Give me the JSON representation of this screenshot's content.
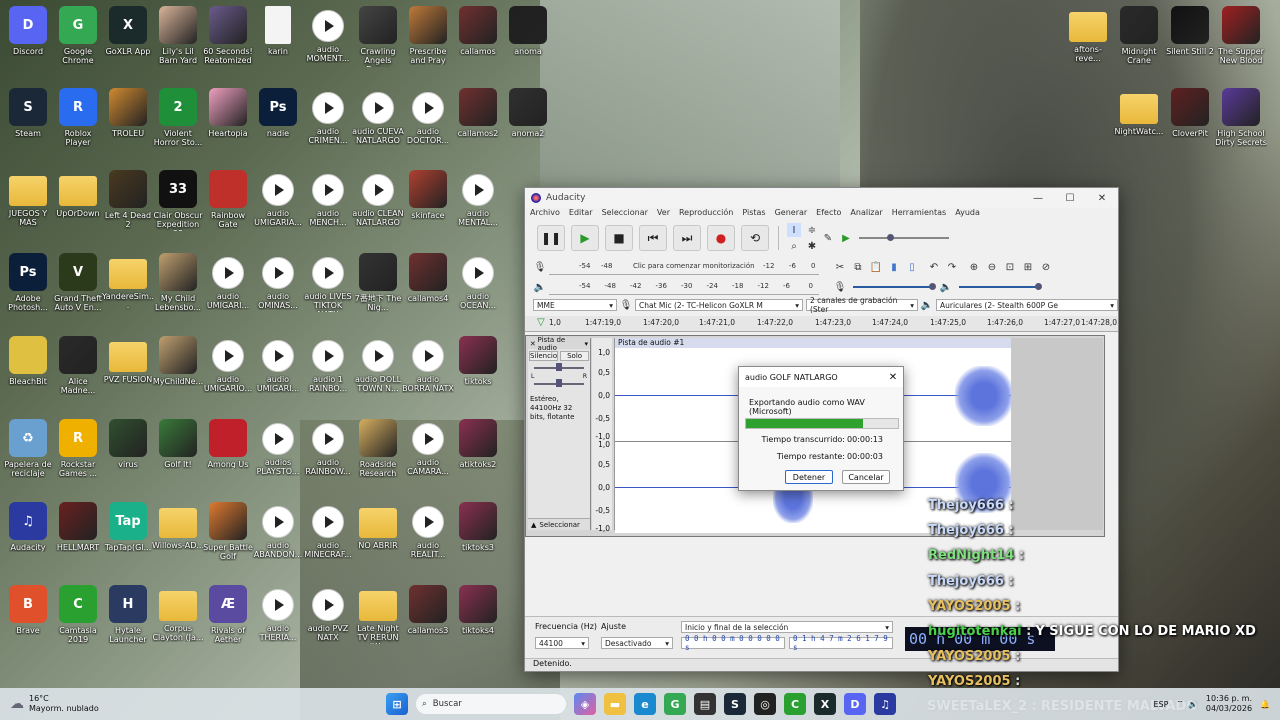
{
  "desktop_icons": [
    {
      "label": "Discord",
      "kind": "app",
      "color": "#5865f2",
      "glyph": "D"
    },
    {
      "label": "Google Chrome",
      "kind": "app",
      "color": "#34a853",
      "glyph": "G"
    },
    {
      "label": "GoXLR App",
      "kind": "app",
      "color": "#1b2a2a",
      "glyph": "X"
    },
    {
      "label": "Lily's Lil Barn Yard",
      "kind": "thumb",
      "color": "#d9b49a",
      "glyph": ""
    },
    {
      "label": "60 Seconds! Reatomized",
      "kind": "thumb",
      "color": "#6b5b8c",
      "glyph": ""
    },
    {
      "label": "karin",
      "kind": "file",
      "color": "#f4f4f4",
      "glyph": ""
    },
    {
      "label": "audio MOMENT...",
      "kind": "audio",
      "color": "#fff",
      "glyph": ""
    },
    {
      "label": "Crawling Angels Demo",
      "kind": "thumb",
      "color": "#444",
      "glyph": ""
    },
    {
      "label": "Prescribe and Pray",
      "kind": "thumb",
      "color": "#c07a3a",
      "glyph": ""
    },
    {
      "label": "callamos",
      "kind": "thumb",
      "color": "#703030",
      "glyph": ""
    },
    {
      "label": "anoma",
      "kind": "thumb",
      "color": "#202020",
      "glyph": ""
    },
    {
      "label": "Steam",
      "kind": "app",
      "color": "#1b2838",
      "glyph": "S"
    },
    {
      "label": "Roblox Player",
      "kind": "app",
      "color": "#2a6cf0",
      "glyph": "R"
    },
    {
      "label": "TROLEU",
      "kind": "thumb",
      "color": "#d08a30",
      "glyph": ""
    },
    {
      "label": "Violent Horror Sto...",
      "kind": "app",
      "color": "#1f8f3a",
      "glyph": "2"
    },
    {
      "label": "Heartopia",
      "kind": "thumb",
      "color": "#f0a0c0",
      "glyph": ""
    },
    {
      "label": "nadie",
      "kind": "app",
      "color": "#0b1e3a",
      "glyph": "Ps"
    },
    {
      "label": "audio CRIMEN...",
      "kind": "audio",
      "color": "#fff",
      "glyph": ""
    },
    {
      "label": "audio CUEVA NATLARGO",
      "kind": "audio",
      "color": "#fff",
      "glyph": ""
    },
    {
      "label": "audio DOCTOR...",
      "kind": "audio",
      "color": "#fff",
      "glyph": ""
    },
    {
      "label": "callamos2",
      "kind": "thumb",
      "color": "#703030",
      "glyph": ""
    },
    {
      "label": "anoma2",
      "kind": "thumb",
      "color": "#303030",
      "glyph": ""
    },
    {
      "label": "JUEGOS Y MAS",
      "kind": "folder",
      "color": "#f0c850",
      "glyph": ""
    },
    {
      "label": "UpOrDown",
      "kind": "folder",
      "color": "#f0c850",
      "glyph": ""
    },
    {
      "label": "Left 4 Dead 2",
      "kind": "thumb",
      "color": "#4a3a20",
      "glyph": ""
    },
    {
      "label": "Clair Obscur Expedition 33",
      "kind": "app",
      "color": "#111",
      "glyph": "33"
    },
    {
      "label": "Rainbow Gate",
      "kind": "app",
      "color": "#c0302a",
      "glyph": ""
    },
    {
      "label": "audio UMIGARIA...",
      "kind": "audio",
      "color": "#fff",
      "glyph": ""
    },
    {
      "label": "audio MENCH...",
      "kind": "audio",
      "color": "#fff",
      "glyph": ""
    },
    {
      "label": "audio CLEAN NATLARGO",
      "kind": "audio",
      "color": "#fff",
      "glyph": ""
    },
    {
      "label": "skinface",
      "kind": "thumb",
      "color": "#b04030",
      "glyph": ""
    },
    {
      "label": "audio MENTAL...",
      "kind": "audio",
      "color": "#fff",
      "glyph": ""
    },
    {
      "label": "Adobe Photosh...",
      "kind": "app",
      "color": "#0b1e3a",
      "glyph": "Ps"
    },
    {
      "label": "Grand Theft Auto V En...",
      "kind": "app",
      "color": "#2a3a1a",
      "glyph": "V"
    },
    {
      "label": "YandereSim...",
      "kind": "folder",
      "color": "#f0c850",
      "glyph": ""
    },
    {
      "label": "My Child Lebensbo...",
      "kind": "thumb",
      "color": "#c0a070",
      "glyph": ""
    },
    {
      "label": "audio UMIGARI...",
      "kind": "audio",
      "color": "#fff",
      "glyph": ""
    },
    {
      "label": "audio OMINAS...",
      "kind": "audio",
      "color": "#fff",
      "glyph": ""
    },
    {
      "label": "audio LIVES TIKTOK NATX",
      "kind": "audio",
      "color": "#fff",
      "glyph": ""
    },
    {
      "label": "7番地下 The Nig...",
      "kind": "thumb",
      "color": "#333",
      "glyph": ""
    },
    {
      "label": "callamos4",
      "kind": "thumb",
      "color": "#703030",
      "glyph": ""
    },
    {
      "label": "audio OCEAN...",
      "kind": "audio",
      "color": "#fff",
      "glyph": ""
    },
    {
      "label": "BleachBit",
      "kind": "app",
      "color": "#e0c040",
      "glyph": ""
    },
    {
      "label": "Alice Madne...",
      "kind": "thumb",
      "color": "#2a2a2a",
      "glyph": ""
    },
    {
      "label": "PVZ FUSION",
      "kind": "folder",
      "color": "#f0c850",
      "glyph": ""
    },
    {
      "label": "MyChildNe...",
      "kind": "thumb",
      "color": "#c0a070",
      "glyph": ""
    },
    {
      "label": "audio UMIGARIO...",
      "kind": "audio",
      "color": "#fff",
      "glyph": ""
    },
    {
      "label": "audio UMIGARI...",
      "kind": "audio",
      "color": "#fff",
      "glyph": ""
    },
    {
      "label": "audio 1 RAINBO...",
      "kind": "audio",
      "color": "#fff",
      "glyph": ""
    },
    {
      "label": "audio DOLL TOWN N...",
      "kind": "audio",
      "color": "#fff",
      "glyph": ""
    },
    {
      "label": "audio BORRA NATX",
      "kind": "audio",
      "color": "#fff",
      "glyph": ""
    },
    {
      "label": "tiktoks",
      "kind": "thumb",
      "color": "#8a3050",
      "glyph": ""
    },
    {
      "label": "Papelera de reciclaje",
      "kind": "app",
      "color": "#6aa0d0",
      "glyph": "♻"
    },
    {
      "label": "Rockstar Games ...",
      "kind": "app",
      "color": "#f0b000",
      "glyph": "R"
    },
    {
      "label": "virus",
      "kind": "thumb",
      "color": "#305030",
      "glyph": ""
    },
    {
      "label": "Golf It!",
      "kind": "thumb",
      "color": "#3a7a3a",
      "glyph": ""
    },
    {
      "label": "Among Us",
      "kind": "app",
      "color": "#c0202a",
      "glyph": ""
    },
    {
      "label": "audios PLAYSTO...",
      "kind": "audio",
      "color": "#fff",
      "glyph": ""
    },
    {
      "label": "audio RAINBOW...",
      "kind": "audio",
      "color": "#fff",
      "glyph": ""
    },
    {
      "label": "Roadside Research",
      "kind": "thumb",
      "color": "#d8b060",
      "glyph": ""
    },
    {
      "label": "audio CAMARA...",
      "kind": "audio",
      "color": "#fff",
      "glyph": ""
    },
    {
      "label": "atiktoks2",
      "kind": "thumb",
      "color": "#8a3050",
      "glyph": ""
    },
    {
      "label": "Audacity",
      "kind": "app",
      "color": "#2a3aa0",
      "glyph": "♫"
    },
    {
      "label": "HELLMART",
      "kind": "thumb",
      "color": "#6a2020",
      "glyph": ""
    },
    {
      "label": "TapTap(Gl...",
      "kind": "app",
      "color": "#1ab08a",
      "glyph": "Tap"
    },
    {
      "label": "Willows-AD...",
      "kind": "folder",
      "color": "#f0c850",
      "glyph": ""
    },
    {
      "label": "Super Battle Golf",
      "kind": "thumb",
      "color": "#e07a30",
      "glyph": ""
    },
    {
      "label": "audio ABANDON...",
      "kind": "audio",
      "color": "#fff",
      "glyph": ""
    },
    {
      "label": "audio MINECRAF...",
      "kind": "audio",
      "color": "#fff",
      "glyph": ""
    },
    {
      "label": "NO ABRIR",
      "kind": "folder",
      "color": "#f0c850",
      "glyph": ""
    },
    {
      "label": "audio REALIT...",
      "kind": "audio",
      "color": "#fff",
      "glyph": ""
    },
    {
      "label": "tiktoks3",
      "kind": "thumb",
      "color": "#8a3050",
      "glyph": ""
    },
    {
      "label": "Brave",
      "kind": "app",
      "color": "#e0502a",
      "glyph": "B"
    },
    {
      "label": "Camtasia 2019",
      "kind": "app",
      "color": "#2aa030",
      "glyph": "C"
    },
    {
      "label": "Hytale Launcher",
      "kind": "app",
      "color": "#2a3a60",
      "glyph": "H"
    },
    {
      "label": "Corpus Clayton (Ja...",
      "kind": "folder",
      "color": "#f0c850",
      "glyph": ""
    },
    {
      "label": "Rivals of Aether",
      "kind": "app",
      "color": "#5a4aa0",
      "glyph": "Æ"
    },
    {
      "label": "audio THERIA...",
      "kind": "audio",
      "color": "#fff",
      "glyph": ""
    },
    {
      "label": "audio PVZ NATX",
      "kind": "audio",
      "color": "#fff",
      "glyph": ""
    },
    {
      "label": "Late Night TV RERUN (W...",
      "kind": "folder",
      "color": "#f0c850",
      "glyph": ""
    },
    {
      "label": "callamos3",
      "kind": "thumb",
      "color": "#703030",
      "glyph": ""
    },
    {
      "label": "tiktoks4",
      "kind": "thumb",
      "color": "#8a3050",
      "glyph": ""
    }
  ],
  "desktop_icons_right": [
    {
      "label": "aftons-reve...",
      "kind": "folder",
      "color": "#f0c850",
      "glyph": ""
    },
    {
      "label": "Midnight Crane",
      "kind": "thumb",
      "color": "#2a2a2a",
      "glyph": ""
    },
    {
      "label": "Silent Still 2",
      "kind": "thumb",
      "color": "#111",
      "glyph": ""
    },
    {
      "label": "The Supper New Blood",
      "kind": "thumb",
      "color": "#a02020",
      "glyph": ""
    },
    {
      "label": "NightWatc...",
      "kind": "folder",
      "color": "#f0c850",
      "glyph": ""
    },
    {
      "label": "CloverPit",
      "kind": "thumb",
      "color": "#602020",
      "glyph": ""
    },
    {
      "label": "High School Dirty Secrets",
      "kind": "thumb",
      "color": "#5a3a9a",
      "glyph": ""
    }
  ],
  "audacity": {
    "title": "Audacity",
    "menu": [
      "Archivo",
      "Editar",
      "Seleccionar",
      "Ver",
      "Reproducción",
      "Pistas",
      "Generar",
      "Efecto",
      "Analizar",
      "Herramientas",
      "Ayuda"
    ],
    "rec_meter_text": "Clic para comenzar monitorización",
    "meter_scale_top": [
      "-54",
      "-48",
      "-12",
      "-6",
      "0"
    ],
    "meter_scale_bottom": [
      "-54",
      "-48",
      "-42",
      "-36",
      "-30",
      "-24",
      "-18",
      "-12",
      "-6",
      "0"
    ],
    "device_host": "MME",
    "device_input": "Chat Mic (2- TC-Helicon GoXLR M",
    "device_channels": "2 canales de grabación (Ster",
    "device_output": "Auriculares (2- Stealth 600P Ge",
    "ruler_ticks": [
      "1,0",
      "1:47:19,0",
      "1:47:20,0",
      "1:47:21,0",
      "1:47:22,0",
      "1:47:23,0",
      "1:47:24,0",
      "1:47:25,0",
      "1:47:26,0",
      "1:47:27,0",
      "1:47:28,0"
    ],
    "track_name": "Pista de audio",
    "clip_name": "Pista de audio #1",
    "mute_label": "Silencio",
    "solo_label": "Solo",
    "track_info": "Estéreo, 44100Hz 32 bits, flotante",
    "select_label": "Seleccionar",
    "scale_labels": [
      "1,0",
      "0,5",
      "0,0",
      "-0,5",
      "-1,0",
      "1,0",
      "0,5",
      "0,0",
      "-0,5",
      "-1,0"
    ],
    "rate_label": "Frecuencia (Hz)",
    "rate_value": "44100",
    "snap_label": "Ajuste",
    "snap_value": "Desactivado",
    "selection_mode": "Inicio y final de la selección",
    "sel_start": "0 0 h 0 0 m 0 0 0 0 0 s",
    "sel_end": "0 1 h 4 7 m 2 6 1 7 9 s",
    "time_big": "00 h 00 m 00 s",
    "status": "Detenido."
  },
  "export_dialog": {
    "title": "audio GOLF NATLARGO",
    "message": "Exportando audio como WAV (Microsoft)",
    "progress": 0.77,
    "elapsed_label": "Tiempo transcurrido:",
    "elapsed_value": "00:00:13",
    "remaining_label": "Tiempo restante:",
    "remaining_value": "00:00:03",
    "stop_label": "Detener",
    "cancel_label": "Cancelar"
  },
  "chat": [
    {
      "user": "Thejoy666",
      "sep": " :",
      "msg": "",
      "color": "#c8d8f8"
    },
    {
      "user": "Thejoy666",
      "sep": " :",
      "msg": "",
      "color": "#c8d8f8"
    },
    {
      "user": "RedNight14",
      "sep": " :",
      "msg": "",
      "color": "#7fe07f"
    },
    {
      "user": "Thejoy666",
      "sep": " :",
      "msg": "",
      "color": "#c8d8f8"
    },
    {
      "user": "YAYOS2005",
      "sep": " :",
      "msg": "",
      "color": "#e8c060"
    },
    {
      "user": "hugitotenkai",
      "sep": " :",
      "msg": "Y SIGUE CON LO DE MARIO XD",
      "color": "#4ad04a"
    },
    {
      "user": "YAYOS2005",
      "sep": " :",
      "msg": "",
      "color": "#e8c060"
    },
    {
      "user": "YAYOS2005",
      "sep": " :",
      "msg": "",
      "color": "#e8c060"
    },
    {
      "user": "SWEETaLEX_2",
      "sep": " :",
      "msg": "RESIDENTE MALVADO",
      "color": "#ffffff"
    }
  ],
  "taskbar": {
    "weather_temp": "16°C",
    "weather_desc": "Mayorm. nublado",
    "search_placeholder": "Buscar",
    "lang": "ESP",
    "time": "10:36 p. m.",
    "date": "04/03/2026"
  }
}
